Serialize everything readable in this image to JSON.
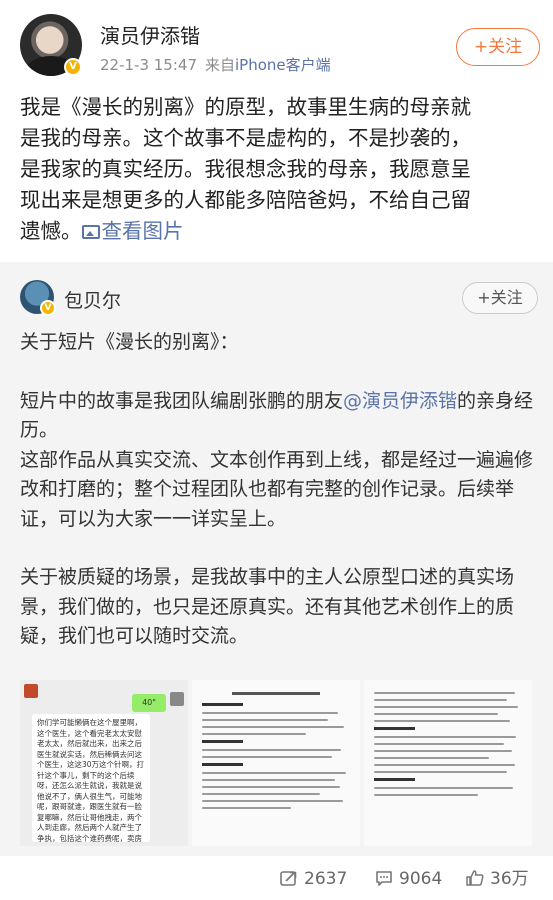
{
  "post": {
    "author": "演员伊添锴",
    "date": "22-1-3 15:47",
    "source_prefix": "来自",
    "source_client": "iPhone客户端",
    "follow_label": "+关注",
    "text_lines": [
      "我是《漫长的别离》的原型，故事里生病的母亲就",
      "是我的母亲。这个故事不是虚构的，不是抄袭的，",
      "是我家的真实经历。我很想念我的母亲，我愿意呈",
      "现出来是想更多的人都能多陪陪爸妈，不给自己留",
      "遗憾。"
    ],
    "view_pictures": "查看图片"
  },
  "repost": {
    "author": "包贝尔",
    "follow_label": "+关注",
    "heading": "关于短片《漫长的别离》：",
    "p1_before": "短片中的故事是我团队编剧张鹏的朋友",
    "p1_mention": "@演员伊添锴",
    "p1_after": "的亲身经历。",
    "p2": "这部作品从真实交流、文本创作再到上线，都是经过一遍遍修改和打磨的；整个过程团队也都有完整的创作记录。后续举证，可以为大家一一详实呈上。",
    "p3": "关于被质疑的场景，是我故事中的主人公原型口述的真实场景，我们做的，也只是还原真实。还有其他艺术创作上的质疑，我们也可以随时交流。",
    "thumb1_reply": "40\"",
    "thumb1_chat": "你们学可能懒俩在这个屋里啊，这个医生，这个看完老太太安慰老太太，然后就出来，出来之后医生就说实话，然后稀俩去问这个医生，这这30万这个针啊，打针这个事儿，剩下的这个后续呀，还怎么派生就说，我就是说他说不了，俩人很生气，可能地呢，跟哥就谁，跟医生就有一脸复哪嘛，然后让哥他拽走，两个人到走廊，然后两个人就产生了争执，包括这个谁药费呢，卖房子啊，着中医呀，尽全力呢。"
  },
  "footer": {
    "reposts": "2637",
    "comments": "9064",
    "likes": "36万"
  },
  "colors": {
    "link": "#5a73a8",
    "follow": "#f27a40",
    "badge": "#f6b400",
    "repost_bg": "#f4f4f4"
  },
  "icons": [
    "verified-badge-icon",
    "picture-icon",
    "repost-icon",
    "comment-icon",
    "like-icon"
  ]
}
